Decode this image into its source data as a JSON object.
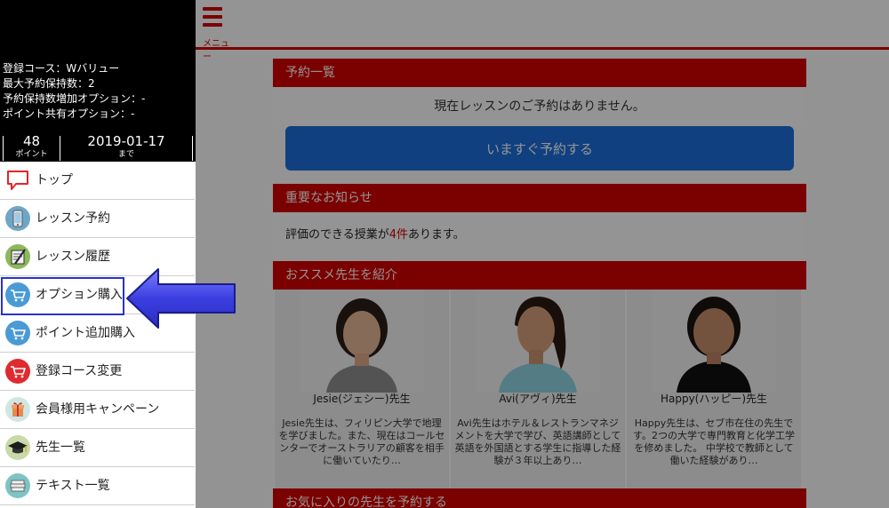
{
  "sidebar": {
    "info": {
      "course": "登録コース：Wバリュー",
      "max_reservations": "最大予約保持数：2",
      "reservation_option": "予約保持数増加オプション：-",
      "point_share_option": "ポイント共有オプション：-"
    },
    "points": {
      "value": "48",
      "label": "ポイント"
    },
    "expiry": {
      "value": "2019-01-17",
      "label": "まで"
    },
    "items": [
      {
        "label": "トップ",
        "icon": "speech-bubble-icon"
      },
      {
        "label": "レッスン予約",
        "icon": "smartphone-icon"
      },
      {
        "label": "レッスン履歴",
        "icon": "notebook-pen-icon"
      },
      {
        "label": "オプション購入",
        "icon": "cart-icon"
      },
      {
        "label": "ポイント追加購入",
        "icon": "cart-icon"
      },
      {
        "label": "登録コース変更",
        "icon": "cart-icon"
      },
      {
        "label": "会員様用キャンペーン",
        "icon": "gift-icon"
      },
      {
        "label": "先生一覧",
        "icon": "graduation-cap-icon"
      },
      {
        "label": "テキスト一覧",
        "icon": "books-icon"
      }
    ]
  },
  "header": {
    "menu_label": "メニュー"
  },
  "main": {
    "reservations": {
      "title": "予約一覧",
      "empty_text": "現在レッスンのご予約はありません。",
      "button": "いますぐ予約する"
    },
    "notice": {
      "title": "重要なお知らせ",
      "text_prefix": "評価のできる授業が",
      "count": "4件",
      "text_suffix": "あります。"
    },
    "teachers": {
      "title": "おススメ先生を紹介",
      "list": [
        {
          "name": "Jesie(ジェシー)先生",
          "desc": "Jesie先生は、フィリピン大学で地理を学びました。また、現在はコールセンターでオーストラリアの顧客を相手に働いていたり…"
        },
        {
          "name": "Avi(アヴィ)先生",
          "desc": "Avi先生はホテル＆レストランマネジメントを大学で学び、英語講師として英語を外国語とする学生に指導した経験が３年以上あり…"
        },
        {
          "name": "Happy(ハッピー)先生",
          "desc": "Happy先生は、セブ市在住の先生です。2つの大学で専門教育と化学工学を修めました。 中学校で教師として働いた経験があり…"
        }
      ]
    },
    "favorites": {
      "title": "お気に入りの先生を予約する"
    }
  },
  "colors": {
    "accent_red": "#d40000",
    "button_blue": "#1e6fdc",
    "highlight_blue": "#2b31c9"
  }
}
